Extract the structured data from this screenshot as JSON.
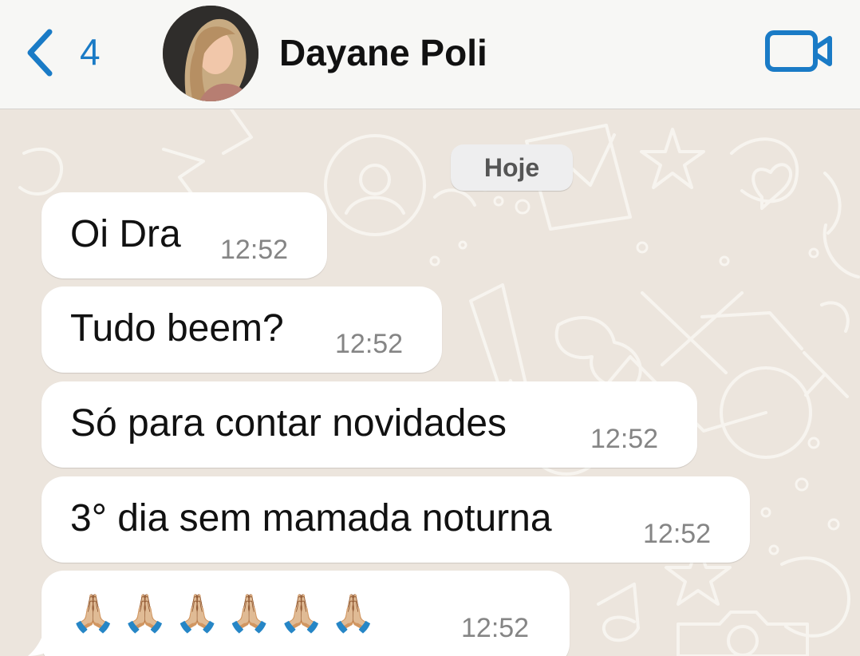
{
  "header": {
    "back_count": "4",
    "contact_name": "Dayane Poli",
    "icons": {
      "back": "chevron-left-icon",
      "video_call": "video-camera-icon",
      "avatar": "contact-photo"
    },
    "accent_color": "#1a7bc6"
  },
  "chat": {
    "date_separator": "Hoje",
    "messages": [
      {
        "text": "Oi Dra",
        "time": "12:52"
      },
      {
        "text": "Tudo beem?",
        "time": "12:52"
      },
      {
        "text": "Só para contar novidades",
        "time": "12:52"
      },
      {
        "text": "3° dia sem mamada noturna",
        "time": "12:52"
      },
      {
        "text": "🙏🏼🙏🏼🙏🏼🙏🏼🙏🏼🙏🏼",
        "time": "12:52"
      }
    ],
    "bubble_color": "#ffffff",
    "background_color": "#ece5dd"
  }
}
